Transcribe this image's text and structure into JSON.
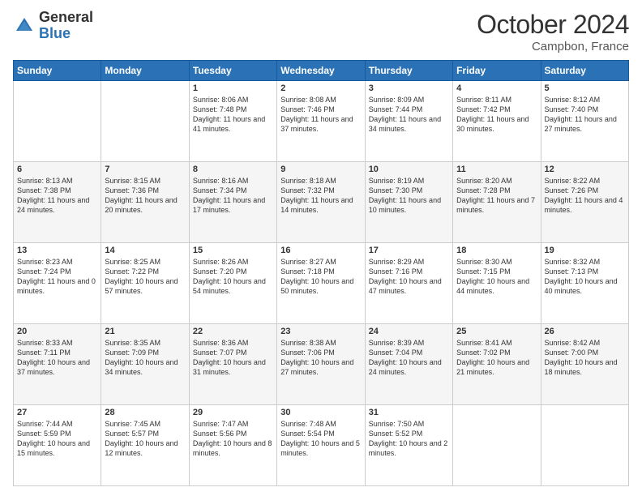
{
  "header": {
    "logo_general": "General",
    "logo_blue": "Blue",
    "month_title": "October 2024",
    "location": "Campbon, France"
  },
  "weekdays": [
    "Sunday",
    "Monday",
    "Tuesday",
    "Wednesday",
    "Thursday",
    "Friday",
    "Saturday"
  ],
  "weeks": [
    [
      null,
      null,
      {
        "day": 1,
        "sunrise": "Sunrise: 8:06 AM",
        "sunset": "Sunset: 7:48 PM",
        "daylight": "Daylight: 11 hours and 41 minutes."
      },
      {
        "day": 2,
        "sunrise": "Sunrise: 8:08 AM",
        "sunset": "Sunset: 7:46 PM",
        "daylight": "Daylight: 11 hours and 37 minutes."
      },
      {
        "day": 3,
        "sunrise": "Sunrise: 8:09 AM",
        "sunset": "Sunset: 7:44 PM",
        "daylight": "Daylight: 11 hours and 34 minutes."
      },
      {
        "day": 4,
        "sunrise": "Sunrise: 8:11 AM",
        "sunset": "Sunset: 7:42 PM",
        "daylight": "Daylight: 11 hours and 30 minutes."
      },
      {
        "day": 5,
        "sunrise": "Sunrise: 8:12 AM",
        "sunset": "Sunset: 7:40 PM",
        "daylight": "Daylight: 11 hours and 27 minutes."
      }
    ],
    [
      {
        "day": 6,
        "sunrise": "Sunrise: 8:13 AM",
        "sunset": "Sunset: 7:38 PM",
        "daylight": "Daylight: 11 hours and 24 minutes."
      },
      {
        "day": 7,
        "sunrise": "Sunrise: 8:15 AM",
        "sunset": "Sunset: 7:36 PM",
        "daylight": "Daylight: 11 hours and 20 minutes."
      },
      {
        "day": 8,
        "sunrise": "Sunrise: 8:16 AM",
        "sunset": "Sunset: 7:34 PM",
        "daylight": "Daylight: 11 hours and 17 minutes."
      },
      {
        "day": 9,
        "sunrise": "Sunrise: 8:18 AM",
        "sunset": "Sunset: 7:32 PM",
        "daylight": "Daylight: 11 hours and 14 minutes."
      },
      {
        "day": 10,
        "sunrise": "Sunrise: 8:19 AM",
        "sunset": "Sunset: 7:30 PM",
        "daylight": "Daylight: 11 hours and 10 minutes."
      },
      {
        "day": 11,
        "sunrise": "Sunrise: 8:20 AM",
        "sunset": "Sunset: 7:28 PM",
        "daylight": "Daylight: 11 hours and 7 minutes."
      },
      {
        "day": 12,
        "sunrise": "Sunrise: 8:22 AM",
        "sunset": "Sunset: 7:26 PM",
        "daylight": "Daylight: 11 hours and 4 minutes."
      }
    ],
    [
      {
        "day": 13,
        "sunrise": "Sunrise: 8:23 AM",
        "sunset": "Sunset: 7:24 PM",
        "daylight": "Daylight: 11 hours and 0 minutes."
      },
      {
        "day": 14,
        "sunrise": "Sunrise: 8:25 AM",
        "sunset": "Sunset: 7:22 PM",
        "daylight": "Daylight: 10 hours and 57 minutes."
      },
      {
        "day": 15,
        "sunrise": "Sunrise: 8:26 AM",
        "sunset": "Sunset: 7:20 PM",
        "daylight": "Daylight: 10 hours and 54 minutes."
      },
      {
        "day": 16,
        "sunrise": "Sunrise: 8:27 AM",
        "sunset": "Sunset: 7:18 PM",
        "daylight": "Daylight: 10 hours and 50 minutes."
      },
      {
        "day": 17,
        "sunrise": "Sunrise: 8:29 AM",
        "sunset": "Sunset: 7:16 PM",
        "daylight": "Daylight: 10 hours and 47 minutes."
      },
      {
        "day": 18,
        "sunrise": "Sunrise: 8:30 AM",
        "sunset": "Sunset: 7:15 PM",
        "daylight": "Daylight: 10 hours and 44 minutes."
      },
      {
        "day": 19,
        "sunrise": "Sunrise: 8:32 AM",
        "sunset": "Sunset: 7:13 PM",
        "daylight": "Daylight: 10 hours and 40 minutes."
      }
    ],
    [
      {
        "day": 20,
        "sunrise": "Sunrise: 8:33 AM",
        "sunset": "Sunset: 7:11 PM",
        "daylight": "Daylight: 10 hours and 37 minutes."
      },
      {
        "day": 21,
        "sunrise": "Sunrise: 8:35 AM",
        "sunset": "Sunset: 7:09 PM",
        "daylight": "Daylight: 10 hours and 34 minutes."
      },
      {
        "day": 22,
        "sunrise": "Sunrise: 8:36 AM",
        "sunset": "Sunset: 7:07 PM",
        "daylight": "Daylight: 10 hours and 31 minutes."
      },
      {
        "day": 23,
        "sunrise": "Sunrise: 8:38 AM",
        "sunset": "Sunset: 7:06 PM",
        "daylight": "Daylight: 10 hours and 27 minutes."
      },
      {
        "day": 24,
        "sunrise": "Sunrise: 8:39 AM",
        "sunset": "Sunset: 7:04 PM",
        "daylight": "Daylight: 10 hours and 24 minutes."
      },
      {
        "day": 25,
        "sunrise": "Sunrise: 8:41 AM",
        "sunset": "Sunset: 7:02 PM",
        "daylight": "Daylight: 10 hours and 21 minutes."
      },
      {
        "day": 26,
        "sunrise": "Sunrise: 8:42 AM",
        "sunset": "Sunset: 7:00 PM",
        "daylight": "Daylight: 10 hours and 18 minutes."
      }
    ],
    [
      {
        "day": 27,
        "sunrise": "Sunrise: 7:44 AM",
        "sunset": "Sunset: 5:59 PM",
        "daylight": "Daylight: 10 hours and 15 minutes."
      },
      {
        "day": 28,
        "sunrise": "Sunrise: 7:45 AM",
        "sunset": "Sunset: 5:57 PM",
        "daylight": "Daylight: 10 hours and 12 minutes."
      },
      {
        "day": 29,
        "sunrise": "Sunrise: 7:47 AM",
        "sunset": "Sunset: 5:56 PM",
        "daylight": "Daylight: 10 hours and 8 minutes."
      },
      {
        "day": 30,
        "sunrise": "Sunrise: 7:48 AM",
        "sunset": "Sunset: 5:54 PM",
        "daylight": "Daylight: 10 hours and 5 minutes."
      },
      {
        "day": 31,
        "sunrise": "Sunrise: 7:50 AM",
        "sunset": "Sunset: 5:52 PM",
        "daylight": "Daylight: 10 hours and 2 minutes."
      },
      null,
      null
    ]
  ]
}
